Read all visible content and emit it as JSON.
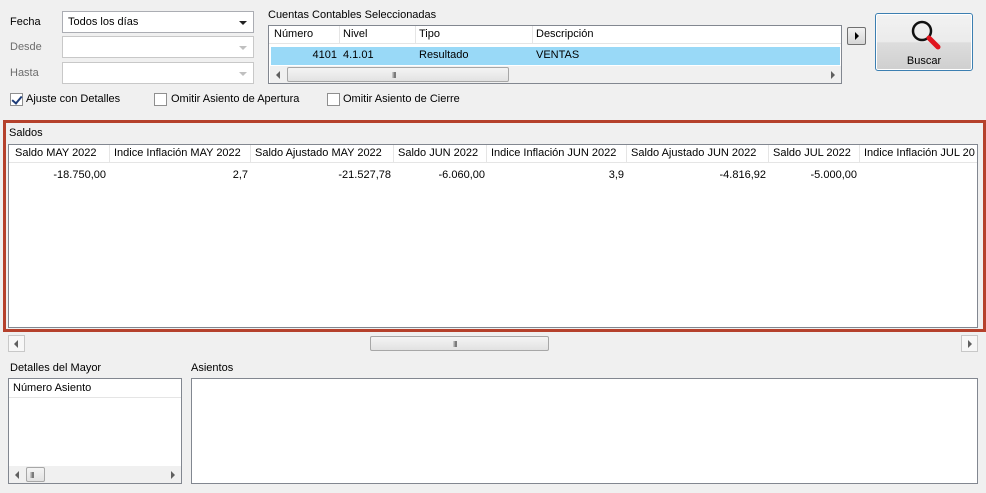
{
  "filters": {
    "fecha_label": "Fecha",
    "fecha_value": "Todos los días",
    "desde_label": "Desde",
    "hasta_label": "Hasta"
  },
  "cuentas": {
    "title": "Cuentas Contables Seleccionadas",
    "columns": [
      "Número",
      "Nivel",
      "Tipo",
      "Descripción"
    ],
    "rows": [
      {
        "numero": "4101",
        "nivel": "4.1.01",
        "tipo": "Resultado",
        "descripcion": "VENTAS"
      }
    ]
  },
  "buscar_label": "Buscar",
  "options": {
    "ajuste": {
      "label": "Ajuste con Detalles",
      "checked": true
    },
    "apertura": {
      "label": "Omitir Asiento de Apertura",
      "checked": false
    },
    "cierre": {
      "label": "Omitir Asiento de Cierre",
      "checked": false
    }
  },
  "saldos": {
    "title": "Saldos",
    "columns": [
      "Saldo MAY 2022",
      "Indice Inflación MAY 2022",
      "Saldo Ajustado MAY 2022",
      "Saldo JUN 2022",
      "Indice Inflación JUN 2022",
      "Saldo Ajustado JUN 2022",
      "Saldo JUL 2022",
      "Indice Inflación JUL 20"
    ],
    "values": [
      "-18.750,00",
      "2,7",
      "-21.527,78",
      "-6.060,00",
      "3,9",
      "-4.816,92",
      "-5.000,00",
      ""
    ]
  },
  "detalles": {
    "title": "Detalles del Mayor",
    "column": "Número Asiento"
  },
  "asientos": {
    "title": "Asientos"
  },
  "scroll_grip": "III",
  "colors": {
    "selection": "#99d9f7",
    "highlight_border": "#b5412c"
  }
}
